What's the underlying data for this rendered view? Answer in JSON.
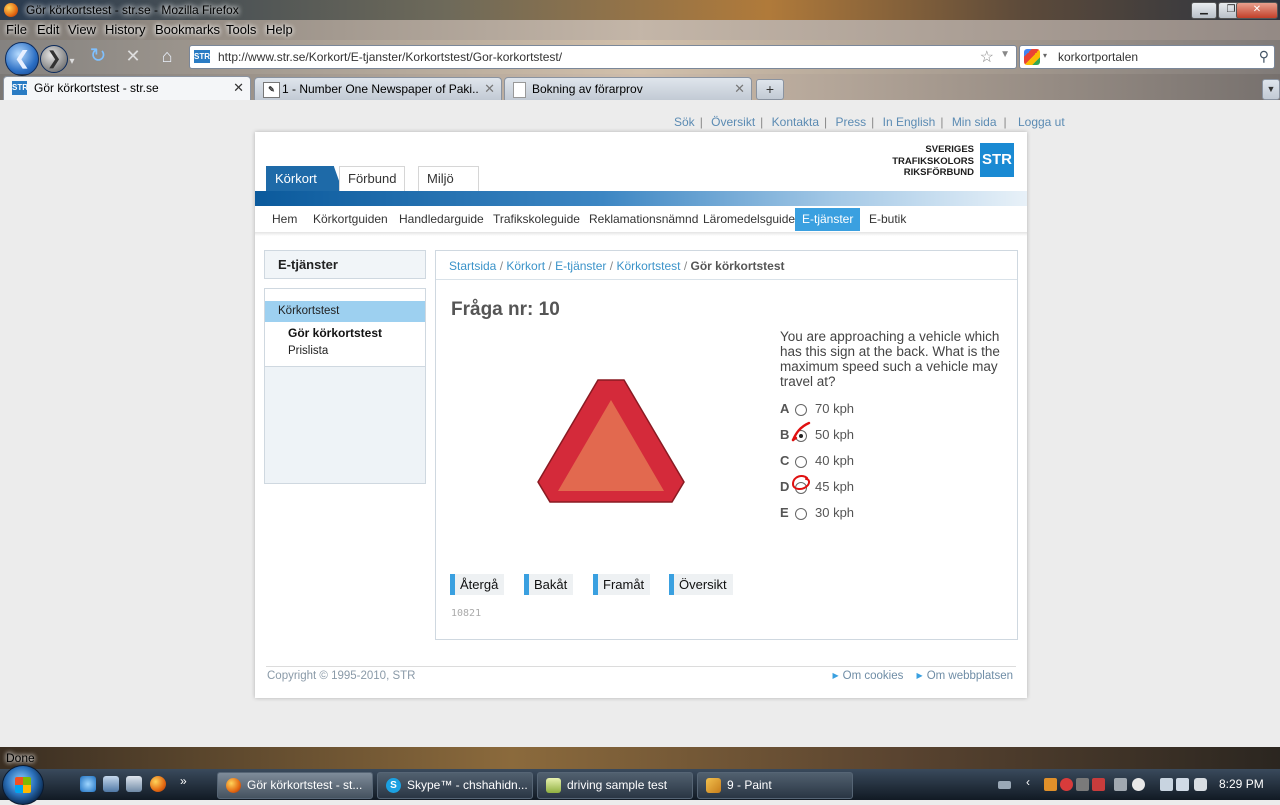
{
  "window": {
    "title": "Gör körkortstest - str.se - Mozilla Firefox",
    "menu": [
      "File",
      "Edit",
      "View",
      "History",
      "Bookmarks",
      "Tools",
      "Help"
    ]
  },
  "browser": {
    "url": "http://www.str.se/Korkort/E-tjanster/Korkortstest/Gor-korkortstest/",
    "search_value": "korkortportalen",
    "url_favicon": "STR",
    "tabs": [
      {
        "label": "Gör körkortstest - str.se",
        "icon": "str-favicon",
        "active": true
      },
      {
        "label": "1 - Number One Newspaper of Paki...",
        "icon": "newspaper-favicon",
        "active": false
      },
      {
        "label": "Bokning av förarprov",
        "icon": "document-favicon",
        "active": false
      }
    ],
    "new_tab_label": "+",
    "status": "Done"
  },
  "page": {
    "top_links": [
      "Sök",
      "Översikt",
      "Kontakta",
      "Press",
      "In English",
      "Min sida",
      "Logga ut"
    ],
    "logo": {
      "line1": "SVERIGES",
      "line2": "TRAFIKSKOLORS",
      "line3": "RIKSFÖRBUND",
      "mark": "STR",
      "color": "#1a8ad3"
    },
    "section_tabs": [
      "Körkort",
      "Förbund",
      "Miljö"
    ],
    "subnav": [
      "Hem",
      "Körkortguiden",
      "Handledarguide",
      "Trafikskoleguide",
      "Reklamationsnämnd",
      "Läromedelsguide",
      "E-tjänster",
      "E-butik"
    ],
    "subnav_active": "E-tjänster",
    "sidebar": {
      "heading": "E-tjänster",
      "current": "Körkortstest",
      "items": [
        "Gör körkortstest",
        "Prislista"
      ]
    },
    "breadcrumb": [
      "Startsida",
      "Körkort",
      "E-tjänster",
      "Körkortstest"
    ],
    "breadcrumb_current": "Gör körkortstest",
    "question": {
      "title": "Fråga nr: 10",
      "text": "You are approaching a vehicle which has this sign at the back. What is the maximum speed such a vehicle may travel at?",
      "sign_icon": "slow-moving-vehicle-triangle-sign",
      "options": [
        {
          "letter": "A",
          "label": "70 kph",
          "selected": false
        },
        {
          "letter": "B",
          "label": "50 kph",
          "selected": true
        },
        {
          "letter": "C",
          "label": "40 kph",
          "selected": false
        },
        {
          "letter": "D",
          "label": "45 kph",
          "selected": false
        },
        {
          "letter": "E",
          "label": "30 kph",
          "selected": false
        }
      ],
      "annotations": {
        "tick_on": "B",
        "circle_on": "D",
        "color": "#e01010"
      }
    },
    "buttons": [
      "Återgå",
      "Bakåt",
      "Framåt",
      "Översikt"
    ],
    "code": "10821",
    "footer": {
      "copyright": "Copyright © 1995-2010, STR",
      "links": [
        "Om cookies",
        "Om webbplatsen"
      ]
    },
    "colors": {
      "accent": "#3aa0e0",
      "brand_blue": "#1e6aa8",
      "sign_red": "#d42a3a",
      "sign_fill": "#e2694f"
    }
  },
  "taskbar": {
    "tasks": [
      {
        "label": "Gör körkortstest - st...",
        "icon": "firefox-icon",
        "active": true
      },
      {
        "label": "Skype™ - chshahidn...",
        "icon": "skype-icon",
        "active": false
      },
      {
        "label": "driving sample test",
        "icon": "notepad-icon",
        "active": false
      },
      {
        "label": "9 - Paint",
        "icon": "paint-icon",
        "active": false
      }
    ],
    "clock": "8:29 PM"
  }
}
